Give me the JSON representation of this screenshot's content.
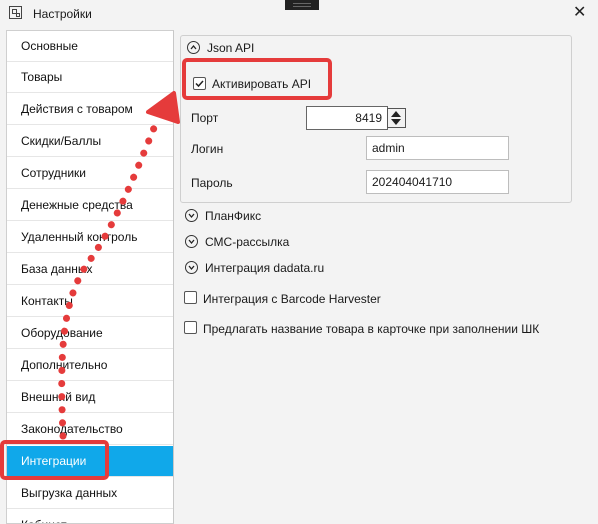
{
  "window": {
    "title": "Настройки"
  },
  "sidebar": {
    "items": [
      {
        "label": "Основные"
      },
      {
        "label": "Товары"
      },
      {
        "label": "Действия с товаром"
      },
      {
        "label": "Скидки/Баллы"
      },
      {
        "label": "Сотрудники"
      },
      {
        "label": "Денежные средства"
      },
      {
        "label": "Удаленный контроль"
      },
      {
        "label": "База данных"
      },
      {
        "label": "Контакты"
      },
      {
        "label": "Оборудование"
      },
      {
        "label": "Дополнительно"
      },
      {
        "label": "Внешний вид"
      },
      {
        "label": "Законодательство"
      },
      {
        "label": "Интеграции"
      },
      {
        "label": "Выгрузка данных"
      },
      {
        "label": "Кабинет"
      }
    ],
    "active": "Интеграции"
  },
  "json_api": {
    "title": "Json API",
    "activate_label": "Активировать API",
    "activate_checked": true,
    "port_label": "Порт",
    "port_value": "8419",
    "login_label": "Логин",
    "login_value": "admin",
    "password_label": "Пароль",
    "password_value": "202404041710"
  },
  "sections": {
    "planfix": "ПланФикс",
    "sms": "СМС-рассылка",
    "dadata": "Интеграция dadata.ru"
  },
  "options": {
    "barcode_harvester": "Интеграция с Barcode Harvester",
    "suggest_name": "Предлагать название товара в карточке при заполнении ШК"
  },
  "annotation_color": "#e53b3b",
  "accent_color": "#10a8ea"
}
